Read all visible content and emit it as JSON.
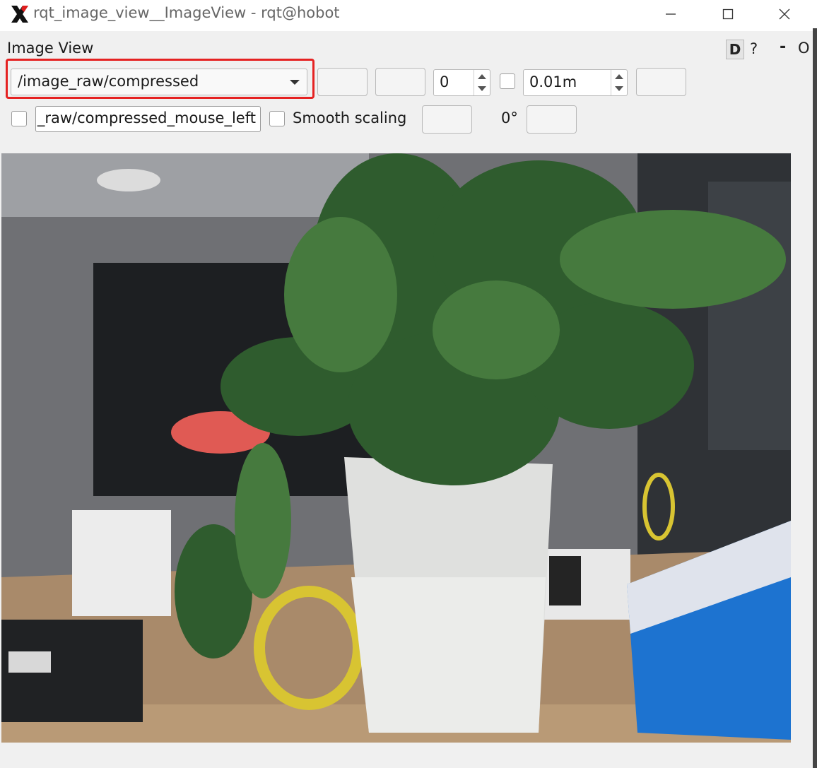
{
  "window": {
    "title": "rqt_image_view__ImageView - rqt@hobot",
    "app_icon": "x-logo-icon",
    "controls": [
      "minimize-icon",
      "maximize-icon",
      "close-icon"
    ]
  },
  "panel": {
    "title": "Image View",
    "d_label": "D",
    "help_label": "?",
    "minimize_label": "-",
    "close_label": "O"
  },
  "toolbar": {
    "topic": "/image_raw/compressed",
    "spin_value": "0",
    "max_range": "0.01m",
    "highlight_color": "#e52222"
  },
  "row2": {
    "mouse_topic": "_raw/compressed_mouse_left",
    "smooth_label": "Smooth scaling",
    "rotation": "0°"
  },
  "image": {
    "subject": "camera-frame-plant"
  }
}
